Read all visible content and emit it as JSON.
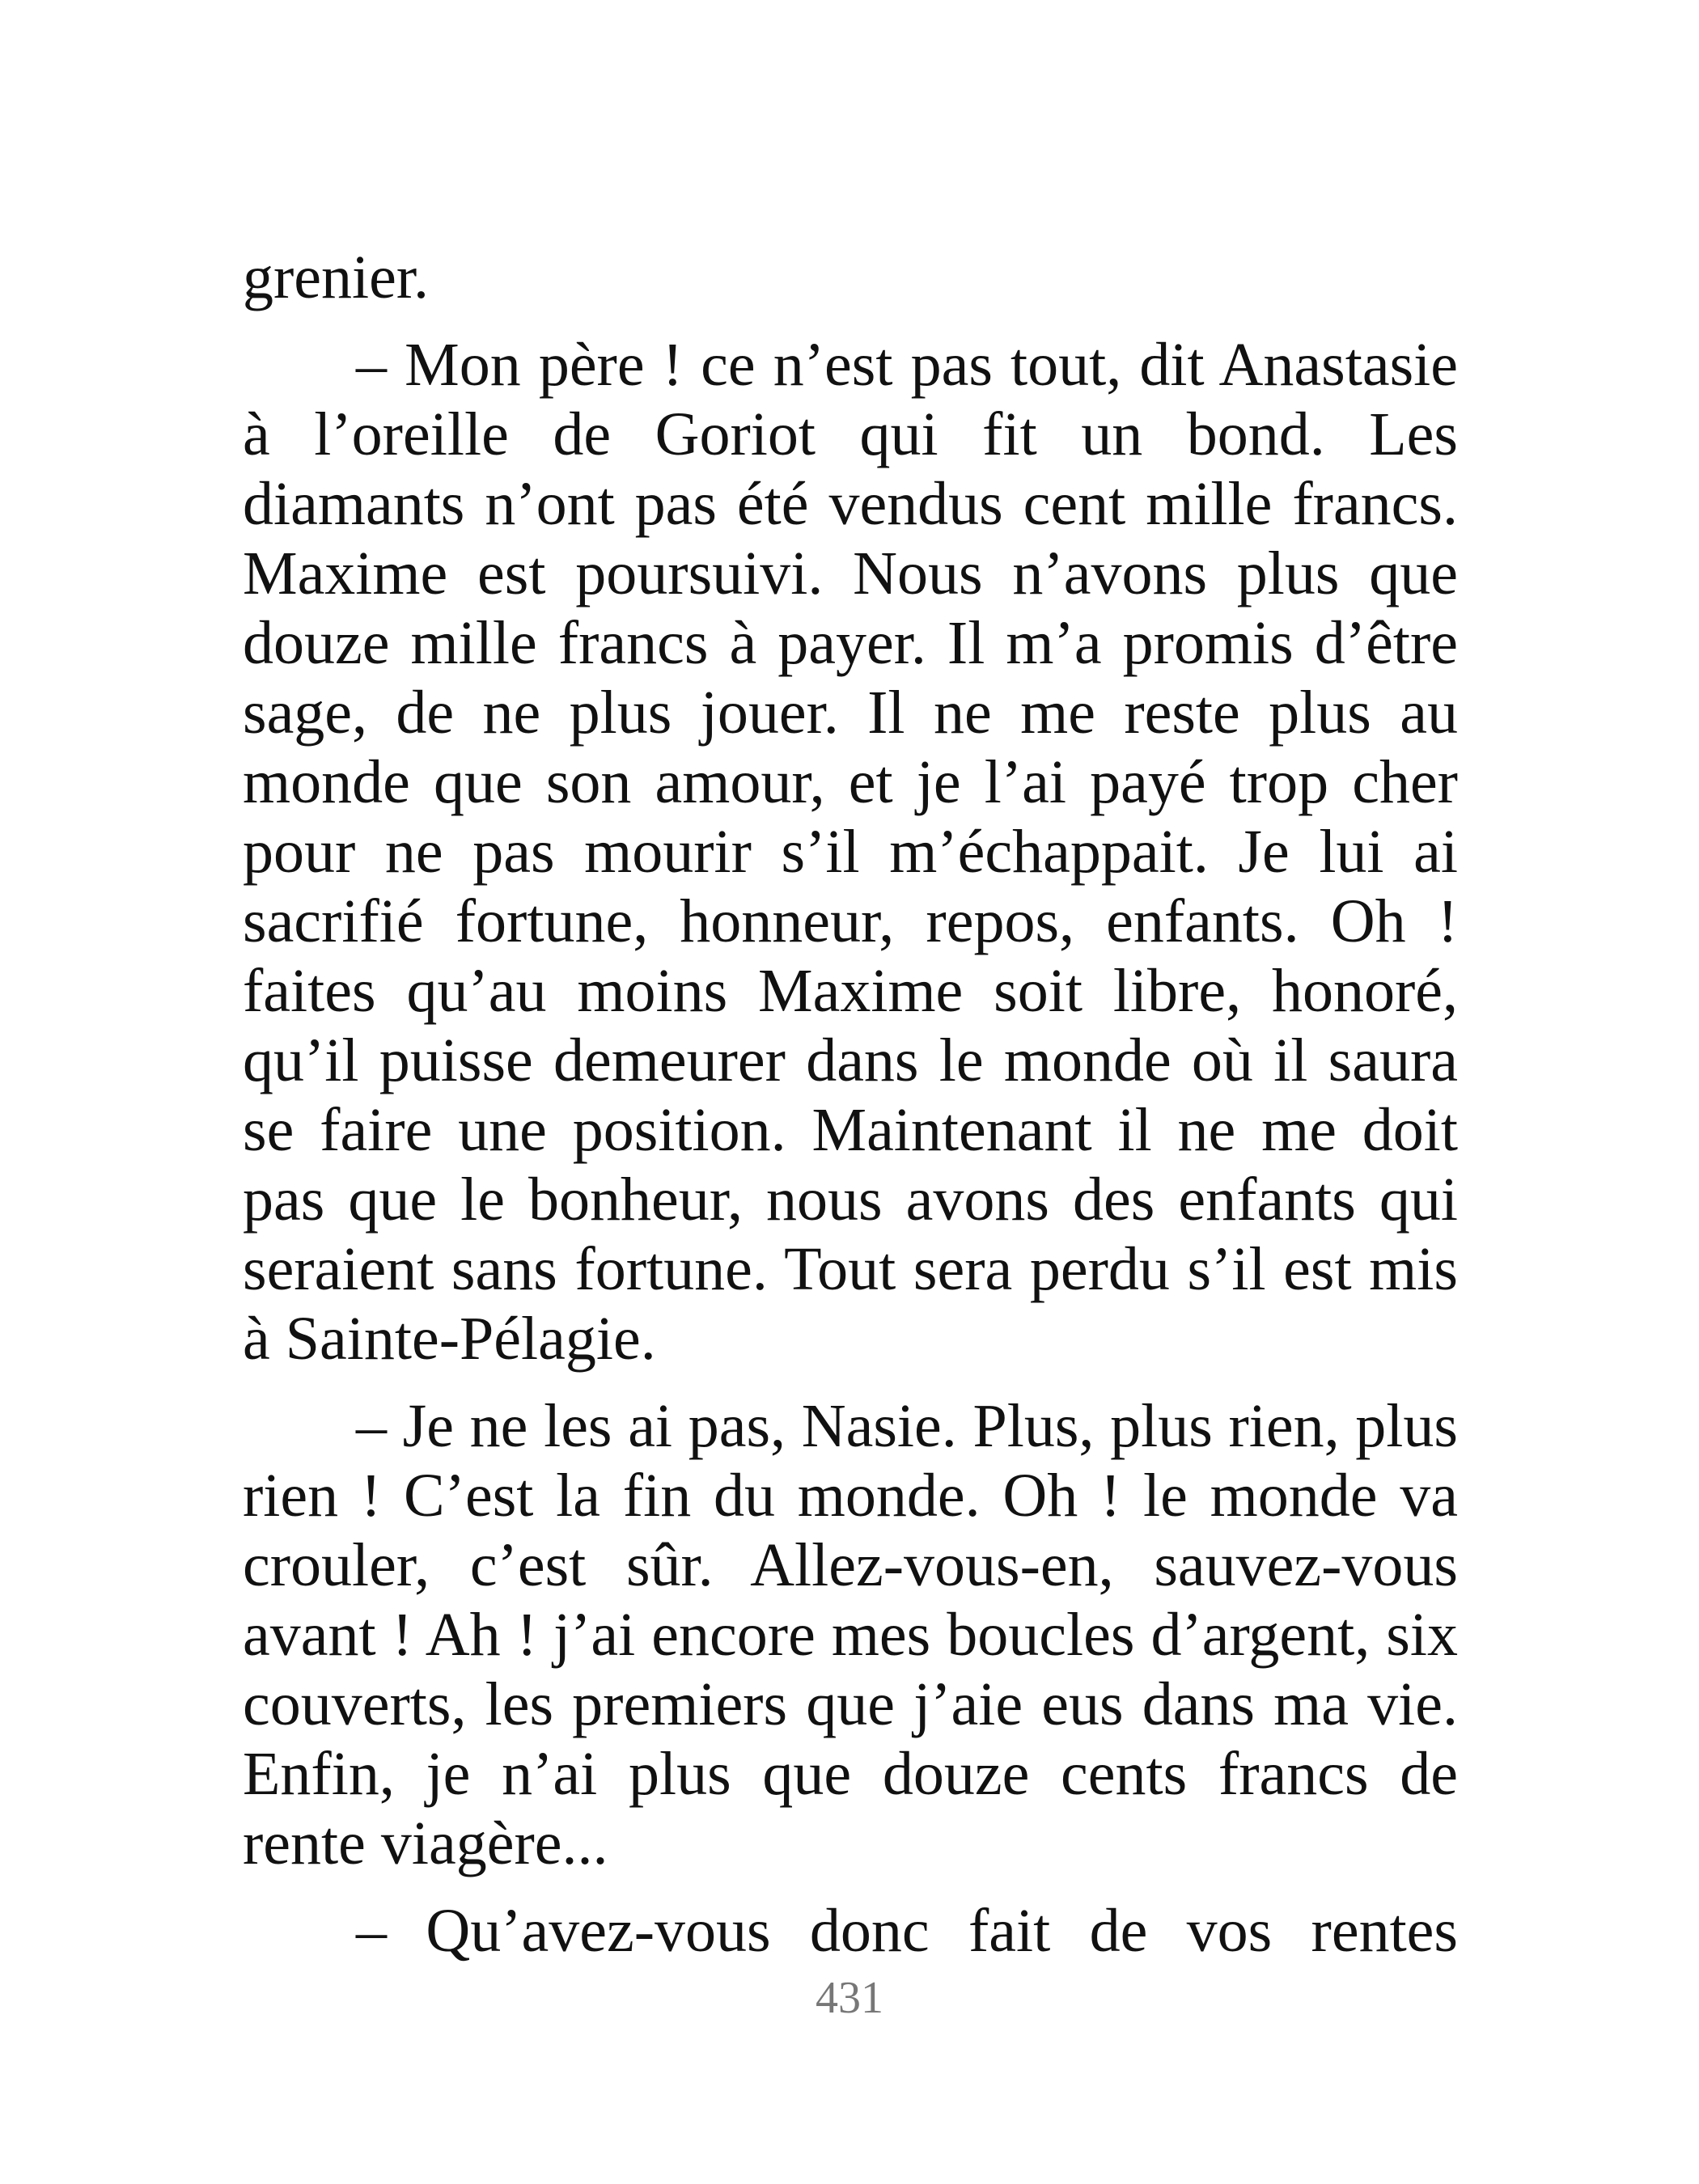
{
  "paragraphs": [
    "grenier.",
    "– Mon père ! ce n’est pas tout, dit Anastasie à l’oreille de Goriot qui fit un bond. Les diamants n’ont pas été vendus cent mille francs. Maxime est poursuivi. Nous n’avons plus que douze mille francs à payer. Il m’a promis d’être sage, de ne plus jouer. Il ne me reste plus au monde que son amour, et je l’ai payé trop cher pour ne pas mourir s’il m’échappait. Je lui ai sacrifié fortune, honneur, repos, enfants. Oh ! faites qu’au moins Maxime soit libre, honoré, qu’il puisse demeurer dans le monde où il saura se faire une position. Maintenant il ne me doit pas que le bonheur, nous avons des enfants qui seraient sans fortune. Tout sera perdu s’il est mis à Sainte-Pélagie.",
    "– Je ne les ai pas, Nasie. Plus, plus rien, plus rien ! C’est la fin du monde. Oh ! le monde va crouler, c’est sûr. Allez-vous-en, sauvez-vous avant ! Ah ! j’ai encore mes boucles d’argent, six couverts, les premiers que j’aie eus dans ma vie. Enfin, je n’ai plus que douze cents francs de rente viagère...",
    "– Qu’avez-vous donc fait de vos rentes"
  ],
  "page_number": "431"
}
